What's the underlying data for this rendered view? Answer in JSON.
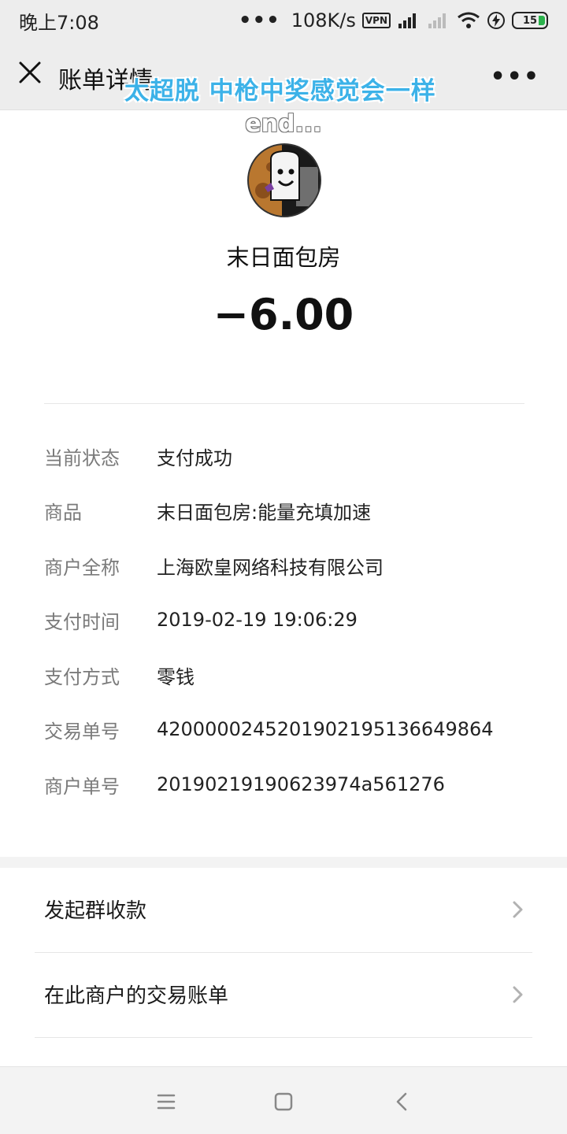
{
  "status_bar": {
    "time": "晚上7:08",
    "dots": "•••",
    "network_speed": "108K/s",
    "vpn": "VPN",
    "battery": "15"
  },
  "nav": {
    "title": "账单详情"
  },
  "overlay": {
    "caption": "太超脱 中枪中奖感觉会一样",
    "end_text": "end..."
  },
  "header": {
    "merchant_name": "末日面包房",
    "amount": "−6.00"
  },
  "details": [
    {
      "label": "当前状态",
      "value": "支付成功"
    },
    {
      "label": "商品",
      "value": "末日面包房:能量充填加速"
    },
    {
      "label": "商户全称",
      "value": "上海欧皇网络科技有限公司"
    },
    {
      "label": "支付时间",
      "value": "2019-02-19 19:06:29"
    },
    {
      "label": "支付方式",
      "value": "零钱"
    },
    {
      "label": "交易单号",
      "value": "4200000245201902195136649864"
    },
    {
      "label": "商户单号",
      "value": "20190219190623974a561276"
    }
  ],
  "actions": [
    {
      "label": "发起群收款"
    },
    {
      "label": "在此商户的交易账单"
    }
  ],
  "colors": {
    "accent_caption": "#3cb2e8",
    "battery_green": "#2bb24c",
    "bar_gray": "#ededed"
  }
}
